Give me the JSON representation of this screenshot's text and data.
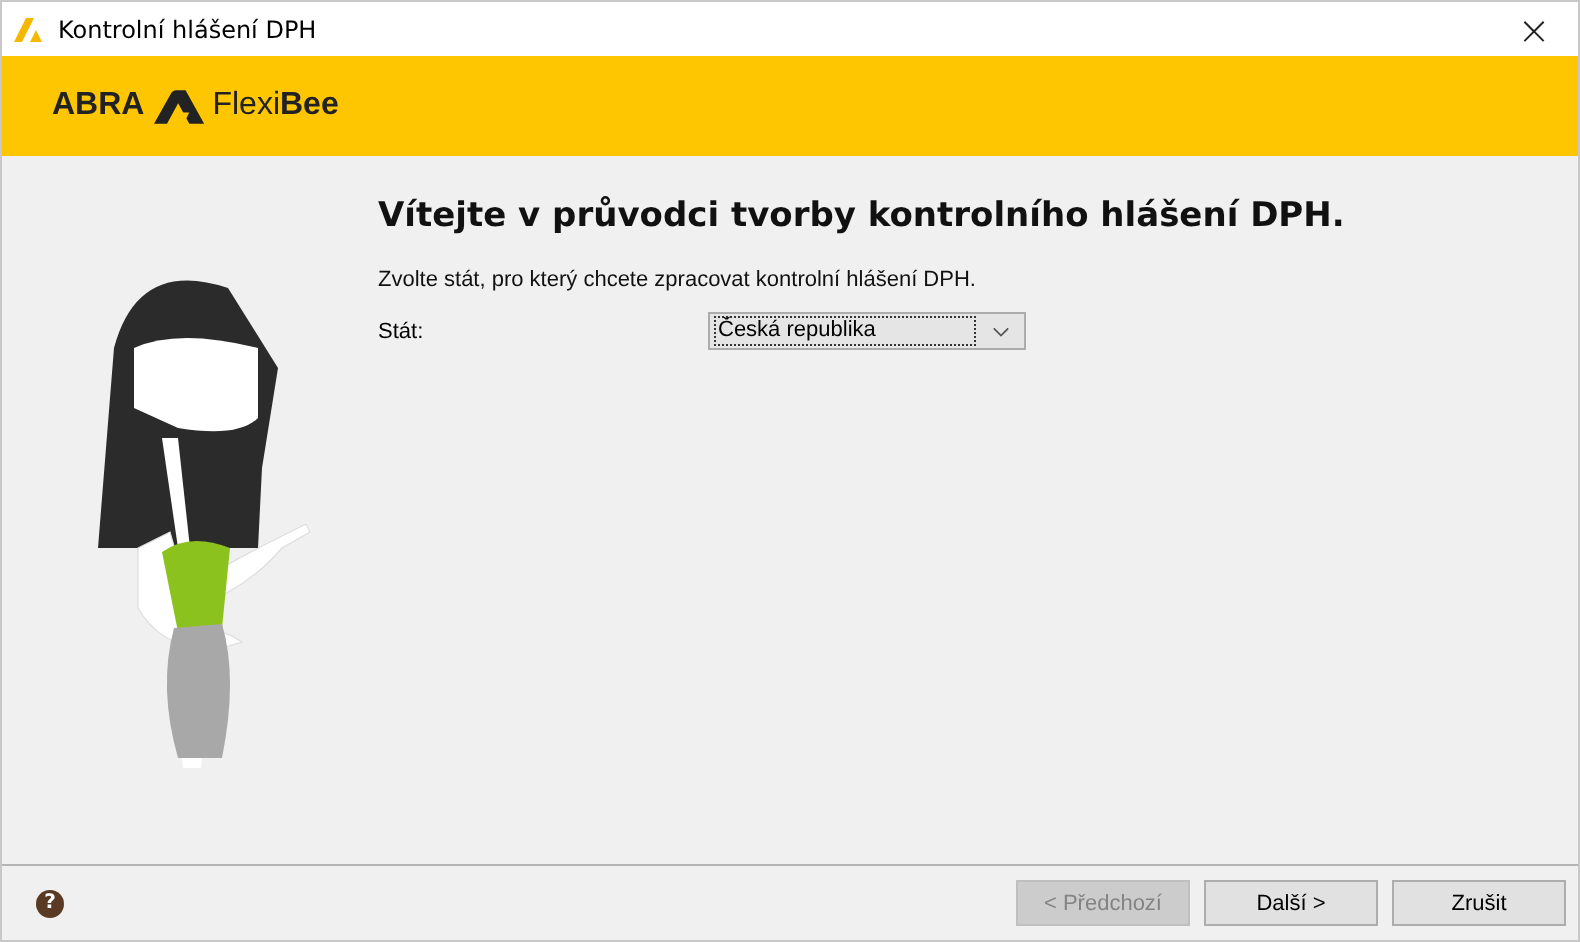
{
  "window": {
    "title": "Kontrolní hlášení DPH",
    "close": "×"
  },
  "logo": {
    "brand": "ABRA",
    "product": "Flexi**Bee**"
  },
  "heading": "Vítejte v průvodci tvorby kontrolního hlášení DPH.",
  "instruction": "Zvolte stát, pro který chcete zpracovat kontrolní hlášení DPH.",
  "country_field": {
    "label": "Stát:",
    "value": "Česká republika",
    "focused": true
  },
  "help": "?",
  "buttons": [
    {
      "label": "< Předchozí",
      "disabled": true
    },
    {
      "label": "Další >",
      "disabled": false
    },
    {
      "label": "Zrušit",
      "disabled": false
    }
  ]
}
